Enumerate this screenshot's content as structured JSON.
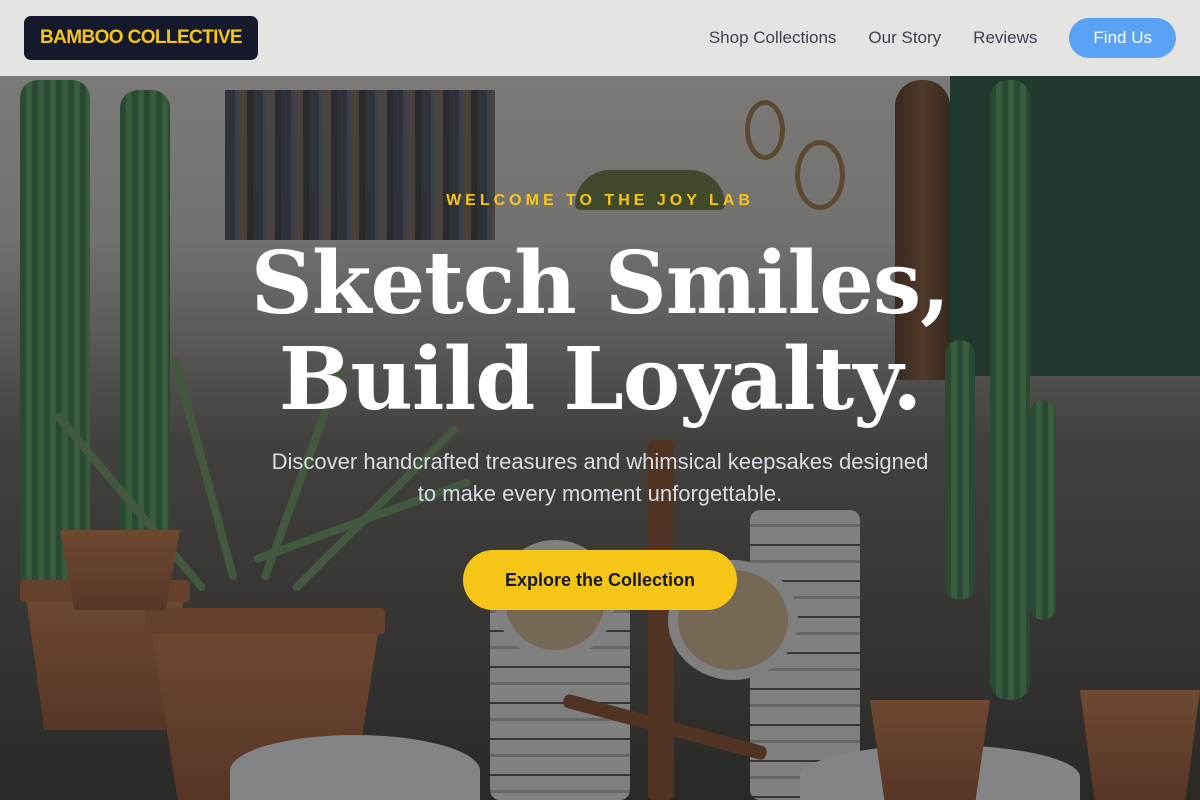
{
  "header": {
    "logo": "BAMBOO COLLECTIVE",
    "nav": [
      {
        "label": "Shop Collections"
      },
      {
        "label": "Our Story"
      },
      {
        "label": "Reviews"
      }
    ],
    "cta_label": "Find Us"
  },
  "hero": {
    "eyebrow": "WELCOME TO THE JOY LAB",
    "headline_line1": "Sketch Smiles,",
    "headline_line2": "Build Loyalty.",
    "subtitle": "Discover handcrafted treasures and whimsical keepsakes designed to make every moment unforgettable.",
    "button_label": "Explore the Collection"
  },
  "colors": {
    "brand_yellow": "#f5c518",
    "logo_bg": "#14192b",
    "cta_blue": "#5aa2f5"
  }
}
